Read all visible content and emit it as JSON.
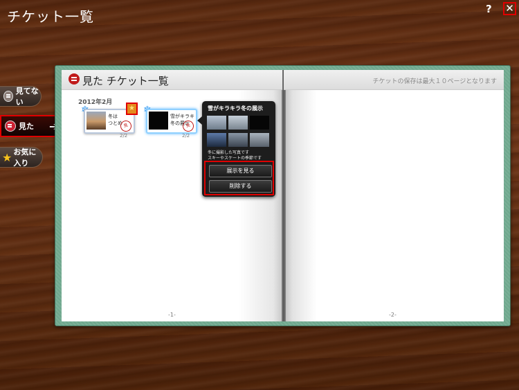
{
  "window": {
    "title": "チケット一覧",
    "help": "?",
    "close": "✕"
  },
  "sidebar": {
    "tabs": [
      {
        "label": "見てない"
      },
      {
        "label": "見た",
        "arrow": "➔"
      },
      {
        "label": "お気に入り"
      }
    ]
  },
  "book": {
    "title": "見た  チケット一覧",
    "notice": "チケットの保存は最大１０ページとなります",
    "month": "2012年2月",
    "page_left": "-1-",
    "page_right": "-2-",
    "tickets": [
      {
        "line1": "冬は",
        "line2": "つとめ",
        "count": "2/2",
        "stamp": "見"
      },
      {
        "line1": "雪がキラキラ",
        "line2": "冬の展示",
        "count": "2/2",
        "stamp": "見"
      }
    ]
  },
  "popup": {
    "title": "雪がキラキラ冬の展示",
    "desc_line1": "冬に撮影した写真です",
    "desc_line2": "スキーやスケートの季節です",
    "view_button": "展示を見る",
    "delete_button": "削除する"
  }
}
